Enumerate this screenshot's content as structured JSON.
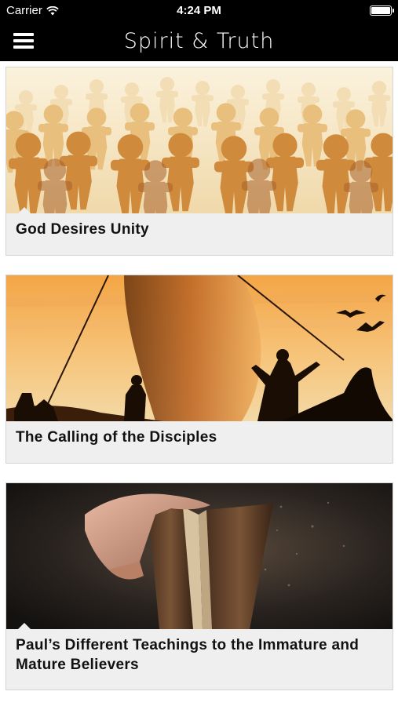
{
  "status_bar": {
    "carrier": "Carrier",
    "time": "4:24 PM",
    "wifi_icon": "wifi-icon",
    "battery_icon": "battery-icon"
  },
  "nav": {
    "title": "Spirit & Truth",
    "menu_icon": "hamburger-menu-icon"
  },
  "articles": [
    {
      "title": "God Desires Unity",
      "image": "paper-people-chain"
    },
    {
      "title": "The Calling of the Disciples",
      "image": "sunset-boat-silhouettes"
    },
    {
      "title": "Paul’s Different Teachings to the Immature and Mature Believers",
      "image": "hand-opening-old-book"
    }
  ],
  "colors": {
    "bar_background": "#000000",
    "card_background": "#efefef",
    "card_border": "#d4d4d4",
    "text": "#111111"
  }
}
